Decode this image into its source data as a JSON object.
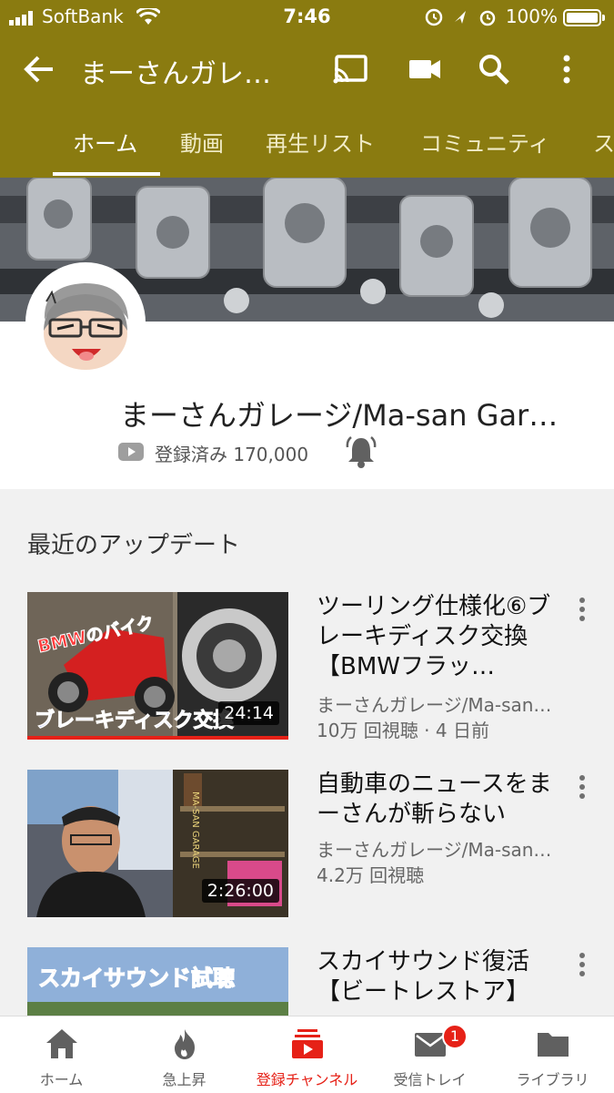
{
  "status_bar": {
    "carrier": "SoftBank",
    "time": "7:46",
    "battery": "100%"
  },
  "app_bar": {
    "title": "まーさんガレ…"
  },
  "tabs": [
    {
      "label": "ホーム",
      "active": true
    },
    {
      "label": "動画"
    },
    {
      "label": "再生リスト"
    },
    {
      "label": "コミュニティ"
    },
    {
      "label": "ス"
    }
  ],
  "channel": {
    "name": "まーさんガレージ/Ma-san Gar…",
    "subscription": "登録済み 170,000"
  },
  "section": {
    "title": "最近のアップデート"
  },
  "videos": [
    {
      "title": "ツーリング仕様化⑥ブレーキディスク交換【BMWフラッ…",
      "channel": "まーさんガレージ/Ma-san…",
      "meta": "10万 回視聴 · 4 日前",
      "duration": "24:14",
      "thumb_text_top": "BMWのバイク",
      "thumb_text_bottom": "ブレーキディスク交換"
    },
    {
      "title": "自動車のニュースをまーさんが斬らない",
      "channel": "まーさんガレージ/Ma-san…",
      "meta": "4.2万 回視聴",
      "duration": "2:26:00",
      "thumb_text_top": "MA-SAN GARAGE"
    },
    {
      "title": "スカイサウンド復活【ビートレストア】",
      "thumb_text_top": "スカイサウンド試聴"
    }
  ],
  "bottom_nav": [
    {
      "label": "ホーム",
      "icon": "home-icon"
    },
    {
      "label": "急上昇",
      "icon": "flame-icon"
    },
    {
      "label": "登録チャンネル",
      "icon": "subscriptions-icon",
      "active": true
    },
    {
      "label": "受信トレイ",
      "icon": "mail-icon",
      "badge": "1"
    },
    {
      "label": "ライブラリ",
      "icon": "folder-icon"
    }
  ],
  "colors": {
    "brand_bar": "#8a7b10",
    "accent_red": "#e62117"
  }
}
